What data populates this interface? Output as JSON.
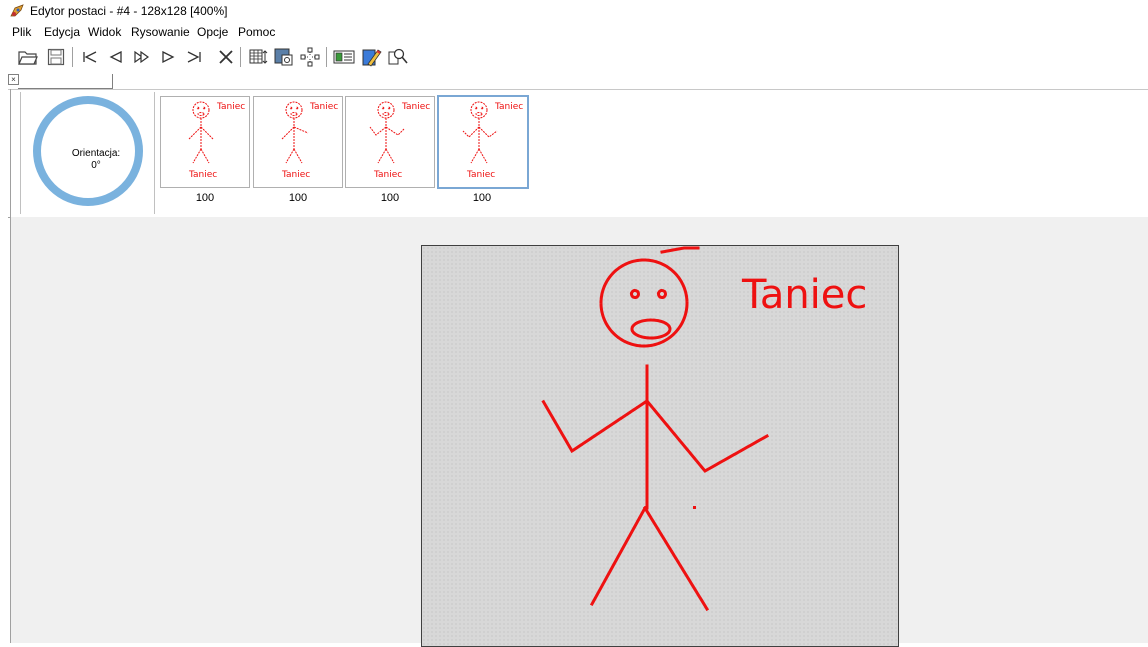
{
  "window": {
    "title": "Edytor postaci - #4 - 128x128 [400%]"
  },
  "menu": [
    "Plik",
    "Edycja",
    "Widok",
    "Rysowanie",
    "Opcje",
    "Pomoc"
  ],
  "toolbar": {
    "buttons": [
      "open-icon",
      "save-icon",
      "first-frame-icon",
      "prev-frame-icon",
      "fast-forward-icon",
      "play-icon",
      "last-frame-icon",
      "delete-icon",
      "frame-settings-icon",
      "preview-icon",
      "grid-icon",
      "show-background-icon",
      "draw-icon",
      "zoom-tool-icon"
    ]
  },
  "orientation": {
    "label": "Orientacja:",
    "value": "0°"
  },
  "frames": [
    {
      "label_top": "Taniec",
      "label_bottom": "Taniec",
      "value": "100",
      "selected": false
    },
    {
      "label_top": "Taniec",
      "label_bottom": "Taniec",
      "value": "100",
      "selected": false
    },
    {
      "label_top": "Taniec",
      "label_bottom": "Taniec",
      "value": "100",
      "selected": false
    },
    {
      "label_top": "Taniec",
      "label_bottom": "Taniec",
      "value": "100",
      "selected": true
    }
  ],
  "canvas": {
    "text": "Taniec",
    "stroke_color": "#ee1111",
    "background": "#d8d8d8"
  }
}
